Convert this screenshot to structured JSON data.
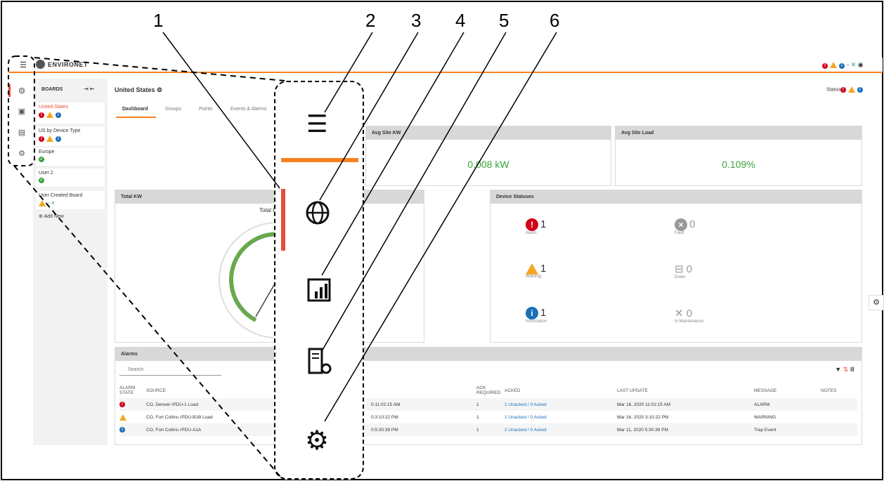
{
  "callout_numbers": [
    "1",
    "2",
    "3",
    "4",
    "5",
    "6"
  ],
  "app": {
    "title": "ENVIRONET"
  },
  "boards": {
    "label": "BOARDS",
    "items": [
      {
        "name": "United States",
        "active": true
      },
      {
        "name": "US by Device Type"
      },
      {
        "name": "Europe"
      },
      {
        "name": "User 2"
      },
      {
        "name": "User Created Board"
      }
    ],
    "add_label": "Add New"
  },
  "main": {
    "title": "United States",
    "status_label": "Status",
    "tabs": [
      "Dashboard",
      "Groups",
      "Points",
      "Events & Alarms"
    ]
  },
  "widgets": {
    "avg_kw": {
      "title": "Avg Site KW",
      "value": "0.008 kW"
    },
    "avg_load": {
      "title": "Avg Site Load",
      "value": "0.109%"
    },
    "total_kw": {
      "title": "Total KW",
      "subtitle": "Total KW"
    },
    "device_statuses": {
      "title": "Device Statuses",
      "items": [
        {
          "count": "1",
          "label": "Alarm"
        },
        {
          "count": "0",
          "label": "Fault"
        },
        {
          "count": "1",
          "label": "Warning"
        },
        {
          "count": "0",
          "label": "Down"
        },
        {
          "count": "1",
          "label": "Information"
        },
        {
          "count": "0",
          "label": "In Maintenance"
        }
      ]
    }
  },
  "alarms": {
    "title": "Alarms",
    "search_placeholder": "Search",
    "columns": [
      "ALARM STATE",
      "SOURCE",
      "ACK REQUIRED",
      "ACKED",
      "LAST UPDATE",
      "MESSAGE",
      "NOTES"
    ],
    "rows": [
      {
        "source": "CO, Denver rPDU-1 Load",
        "time": "0:11:02:15 AM",
        "ack": "1",
        "acked": "1 Unacked / 0 Acked",
        "last": "Mar 16, 2020 11:02:15 AM",
        "message": "ALARM"
      },
      {
        "source": "CO, Fort Collins rPDU-B1B Load",
        "time": "0:3:10:22 PM",
        "ack": "1",
        "acked": "1 Unacked / 0 Acked",
        "last": "Mar 16, 2020 3:10:22 PM",
        "message": "WARNING"
      },
      {
        "source": "CO, Fort Collins rPDU-A1A",
        "time": "0:5:30:39 PM",
        "ack": "1",
        "acked": "2 Unacked / 0 Acked",
        "last": "Mar 11, 2020 5:30:39 PM",
        "message": "Trap Event"
      }
    ]
  }
}
